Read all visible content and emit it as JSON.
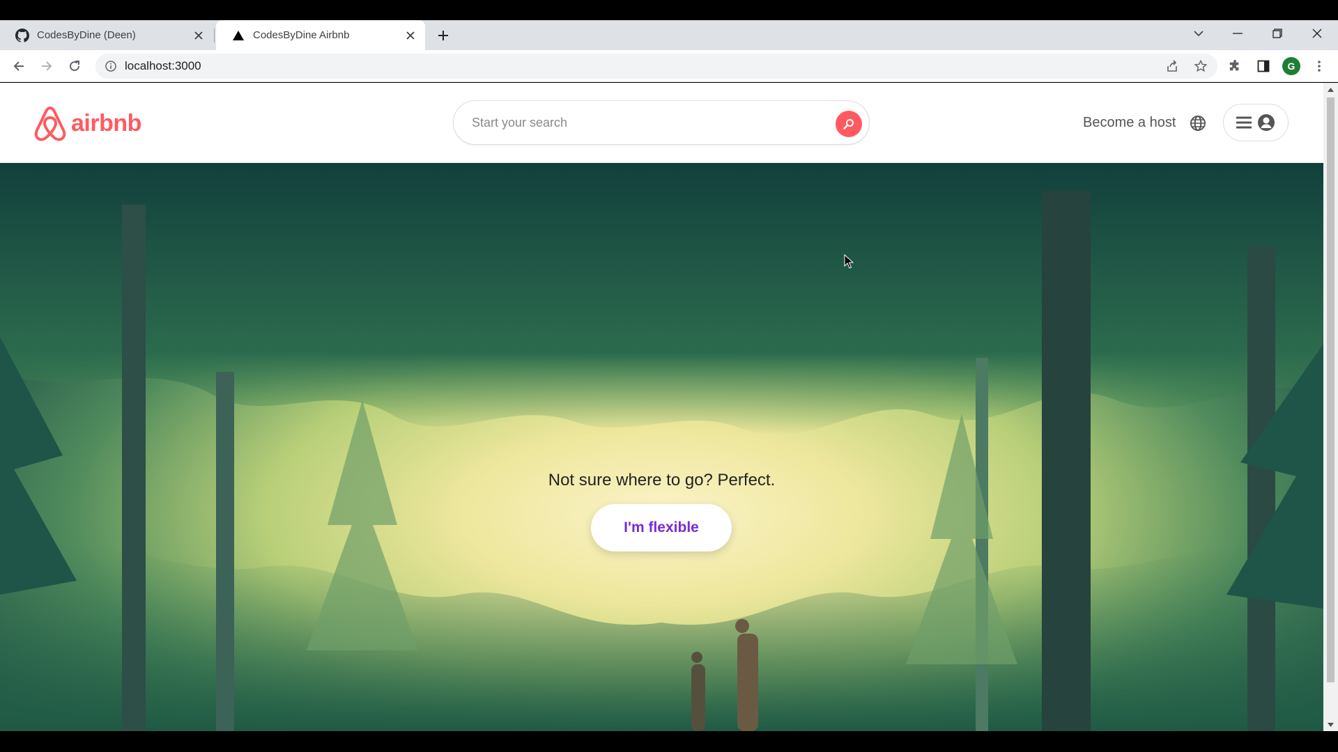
{
  "browser": {
    "tabs": [
      {
        "title": "CodesByDine (Deen)",
        "icon": "github-icon",
        "active": false
      },
      {
        "title": "CodesByDine Airbnb",
        "icon": "triangle-icon",
        "active": true
      }
    ],
    "url": "localhost:3000",
    "profile_initial": "G"
  },
  "site": {
    "logo_text": "airbnb",
    "search_placeholder": "Start your search",
    "become_host": "Become a host",
    "hero": {
      "tagline": "Not sure where to go? Perfect.",
      "button_label": "I'm flexible"
    }
  },
  "colors": {
    "brand": "#ff5a60",
    "flexible_text": "#7a2ad6"
  }
}
